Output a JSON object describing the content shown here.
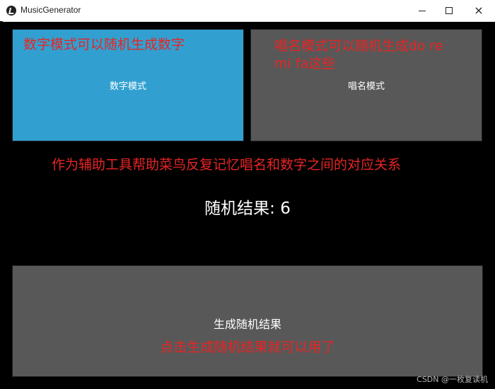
{
  "window": {
    "title": "MusicGenerator",
    "minimize": "minimize-icon",
    "maximize": "maximize-icon",
    "close": "×"
  },
  "buttons": {
    "number_mode": "数字模式",
    "solfege_mode": "唱名模式",
    "generate": "生成随机结果"
  },
  "annotations": {
    "number_mode_note": "数字模式可以随机生成数字",
    "solfege_mode_note": "唱名模式可以随机生成do re mi fa这些",
    "purpose_note": "作为辅助工具帮助菜鸟反复记忆唱名和数字之间的对应关系",
    "generate_note": "点击生成随机结果就可以用了"
  },
  "result": {
    "text": "随机结果: 6"
  },
  "watermark": "CSDN @一枚复读机",
  "colors": {
    "number_mode": "#31a0d0",
    "button_gray": "#585858",
    "annotation_red": "#e82424",
    "background": "#000000"
  }
}
